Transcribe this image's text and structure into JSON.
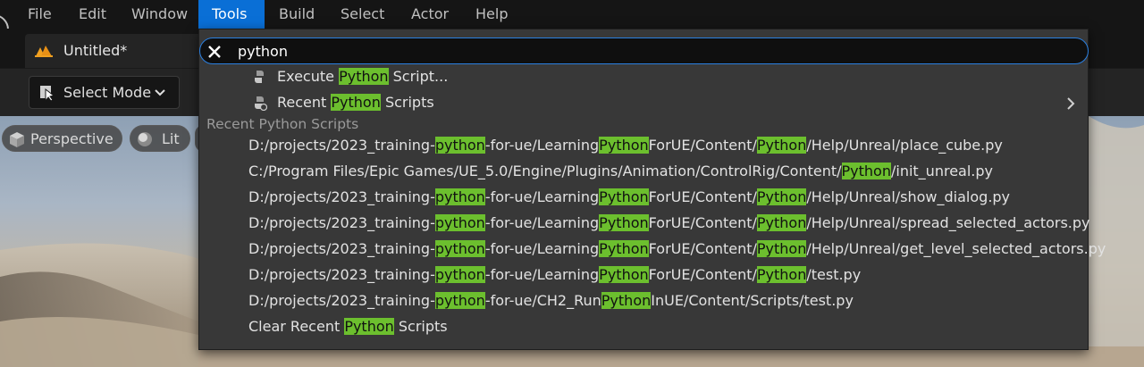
{
  "menubar": {
    "items": [
      {
        "label": "File"
      },
      {
        "label": "Edit"
      },
      {
        "label": "Window"
      },
      {
        "label": "Tools"
      },
      {
        "label": "Build"
      },
      {
        "label": "Select"
      },
      {
        "label": "Actor"
      },
      {
        "label": "Help"
      }
    ],
    "active": "Tools"
  },
  "level_tab": {
    "label": "Untitled*"
  },
  "toolbar": {
    "select_mode_label": "Select Mode"
  },
  "viewport": {
    "perspective_label": "Perspective",
    "lit_label": "Lit"
  },
  "search": {
    "value": "python",
    "commands": [
      {
        "parts": [
          "Execute ",
          "Python",
          " Script..."
        ],
        "icon": "python-script-icon"
      },
      {
        "parts": [
          "Recent ",
          "Python",
          " Scripts"
        ],
        "icon": "recent-python-icon",
        "submenu": true
      }
    ],
    "section_header": "Recent Python Scripts",
    "recent_scripts": [
      {
        "parts": [
          "D:/projects/2023_training-",
          "python",
          "-for-ue/Learning",
          "Python",
          "ForUE/Content/",
          "Python",
          "/Help/Unreal/place_cube.py"
        ]
      },
      {
        "parts": [
          "C:/Program Files/Epic Games/UE_5.0/Engine/Plugins/Animation/ControlRig/Content/",
          "Python",
          "/init_unreal.py"
        ]
      },
      {
        "parts": [
          "D:/projects/2023_training-",
          "python",
          "-for-ue/Learning",
          "Python",
          "ForUE/Content/",
          "Python",
          "/Help/Unreal/show_dialog.py"
        ]
      },
      {
        "parts": [
          "D:/projects/2023_training-",
          "python",
          "-for-ue/Learning",
          "Python",
          "ForUE/Content/",
          "Python",
          "/Help/Unreal/spread_selected_actors.py"
        ]
      },
      {
        "parts": [
          "D:/projects/2023_training-",
          "python",
          "-for-ue/Learning",
          "Python",
          "ForUE/Content/",
          "Python",
          "/Help/Unreal/get_level_selected_actors.py"
        ]
      },
      {
        "parts": [
          "D:/projects/2023_training-",
          "python",
          "-for-ue/Learning",
          "Python",
          "ForUE/Content/",
          "Python",
          "/test.py"
        ]
      },
      {
        "parts": [
          "D:/projects/2023_training-",
          "python",
          "-for-ue/CH2_Run",
          "Python",
          "InUE/Content/Scripts/test.py"
        ]
      }
    ],
    "clear_item": {
      "parts": [
        "Clear Recent ",
        "Python",
        " Scripts"
      ]
    }
  },
  "colors": {
    "menu_active": "#0a6fd6",
    "highlight": "#6cbf2e",
    "popup_bg": "#383838",
    "search_border": "#2a7fe0"
  }
}
